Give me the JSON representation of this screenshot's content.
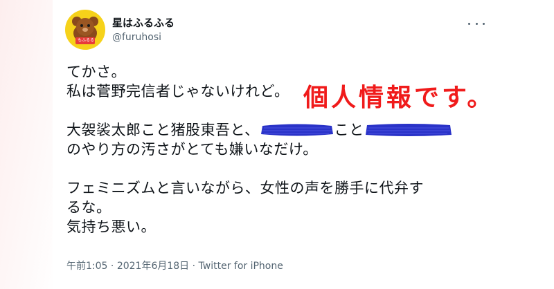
{
  "user": {
    "display_name": "星はふるふる",
    "handle": "@furuhosi",
    "avatar_badge": "もふるる"
  },
  "tweet": {
    "line1": "てかさ。",
    "line2": "私は菅野完信者じゃないけれど。",
    "line3_part1": "大袈裟太郎こと猪股東吾と、",
    "line3_part2": "こと",
    "line4": "のやり方の汚さがとても嫌いなだけ。",
    "line5": "フェミニズムと言いながら、女性の声を勝手に代弁す",
    "line6": "るな。",
    "line7": "気持ち悪い。"
  },
  "annotation": "個人情報です。",
  "meta": {
    "time": "午前1:05",
    "date": "2021年6月18日",
    "source": "Twitter for iPhone"
  },
  "colors": {
    "annotation": "#f01b1b",
    "redaction": "#2a33c8",
    "avatar_bg": "#f6d21a"
  }
}
